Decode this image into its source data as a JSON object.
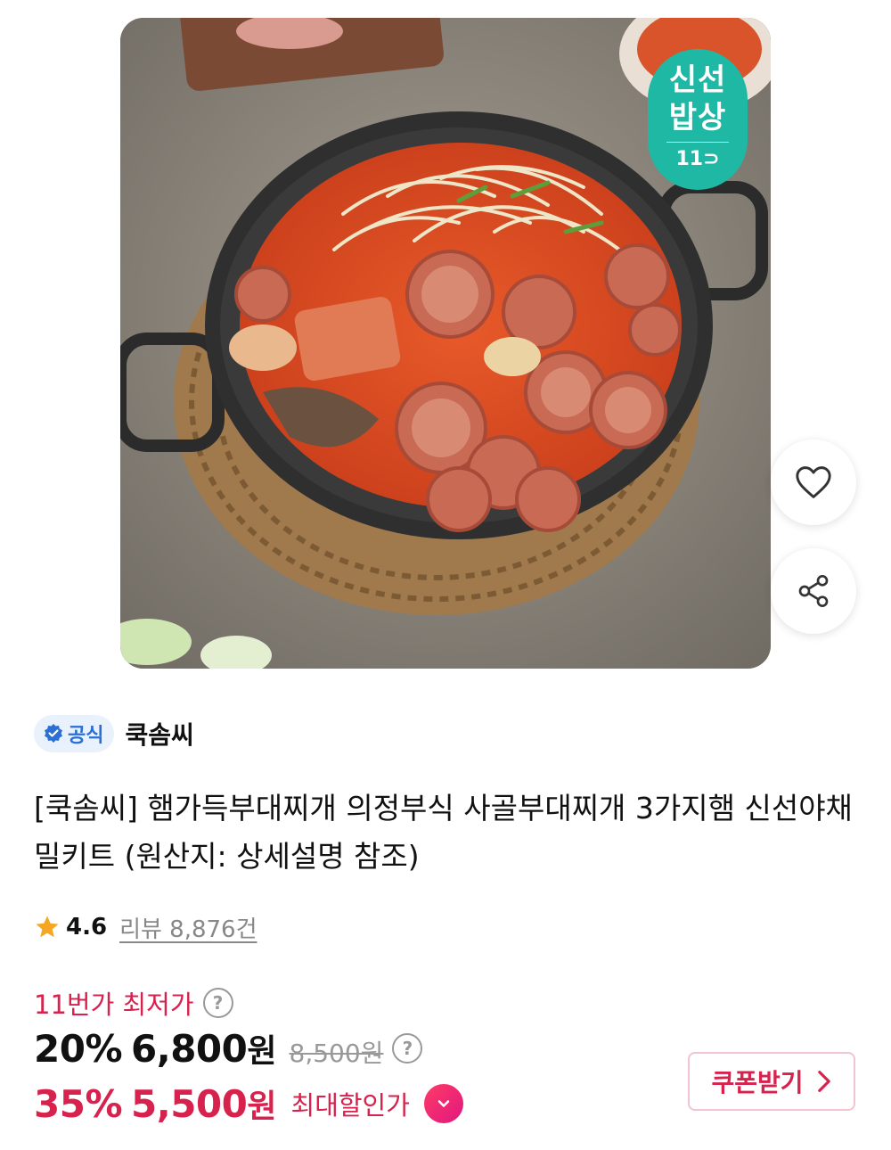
{
  "product_image": {
    "badge": {
      "line1": "신선",
      "line2": "밥상",
      "brand": "11"
    }
  },
  "actions": {
    "like_icon": "heart-outline-icon",
    "share_icon": "share-icon"
  },
  "seller": {
    "official_label": "공식",
    "name": "쿡솜씨"
  },
  "title": "[쿡솜씨] 햄가득부대찌개 의정부식 사골부대찌개 3가지햄 신선야채 밀키트 (원산지: 상세설명 참조)",
  "rating": {
    "score": "4.6",
    "review_text": "리뷰 8,876건"
  },
  "pricing": {
    "lowest_label": "11번가 최저가",
    "row1": {
      "discount": "20%",
      "price": "6,800",
      "unit": "원",
      "original": "8,500원"
    },
    "row2": {
      "discount": "35%",
      "price": "5,500",
      "unit": "원",
      "label": "최대할인가"
    },
    "coupon_label": "쿠폰받기"
  },
  "colors": {
    "accent": "#d7224d",
    "badge_teal": "#1fb8a4",
    "official_blue": "#2a6fd6"
  }
}
